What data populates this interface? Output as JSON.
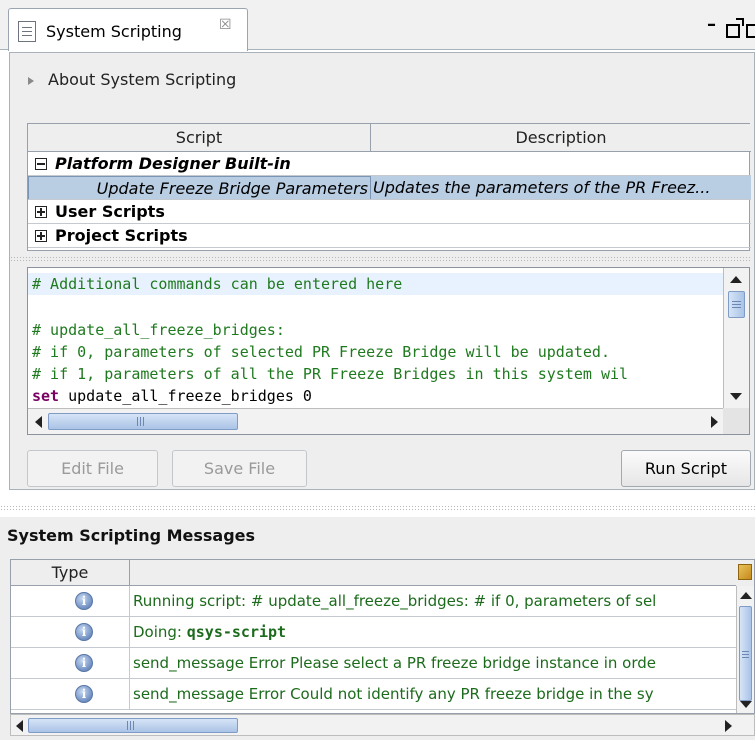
{
  "tab": {
    "title": "System Scripting",
    "close_symbol": "☒"
  },
  "about": {
    "label": "About System Scripting"
  },
  "scripts_table": {
    "columns": [
      "Script",
      "Description"
    ],
    "groups": [
      {
        "label": "Platform Designer Built-in",
        "expanded": true
      },
      {
        "label": "User Scripts",
        "expanded": false
      },
      {
        "label": "Project Scripts",
        "expanded": false
      }
    ],
    "selected_row": {
      "script": "Update Freeze Bridge Parameters",
      "description": "Updates the parameters of the PR Freez..."
    }
  },
  "editor": {
    "line1": "# Additional commands can be entered here",
    "line3": "# update_all_freeze_bridges:",
    "line4": "# if 0, parameters of selected PR Freeze Bridge will be updated.",
    "line5": "# if 1, parameters of all the PR Freeze Bridges in this system wil",
    "line6_keyword": "set",
    "line6_rest": " update_all_freeze_bridges 0"
  },
  "buttons": {
    "edit_file": "Edit File",
    "save_file": "Save File",
    "run_script": "Run Script"
  },
  "messages": {
    "title": "System Scripting Messages",
    "columns": [
      "Type",
      ""
    ],
    "rows": [
      {
        "icon": "info-icon",
        "text": "Running script: # update_all_freeze_bridges: # if 0, parameters of sel"
      },
      {
        "icon": "info-icon",
        "prefix": "Doing: ",
        "bold": "qsys-script"
      },
      {
        "icon": "info-icon",
        "text": "send_message Error Please select a PR freeze bridge instance in orde"
      },
      {
        "icon": "info-icon",
        "text": "send_message Error Could not identify any PR freeze bridge in the sy"
      }
    ]
  },
  "colors": {
    "comment": "#1f7a1f",
    "keyword": "#7a0062",
    "selection": "#b9cde3",
    "message_text": "#1c6b1c"
  }
}
